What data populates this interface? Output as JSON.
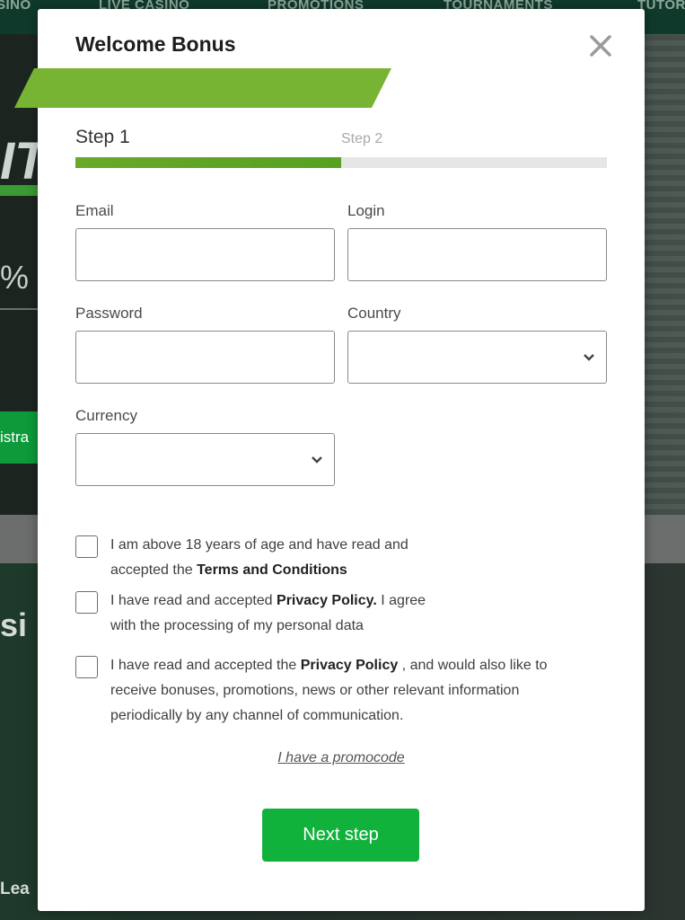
{
  "background": {
    "nav": [
      "SINO",
      "LIVE CASINO",
      "PROMOTIONS",
      "TOURNAMENTS",
      "TUTOR"
    ],
    "hero_fragment": "IT",
    "percent_fragment": "% U",
    "register_fragment": "istra",
    "casino_fragment": "si",
    "league_fragment": "Lea"
  },
  "modal": {
    "title": "Welcome Bonus",
    "close_icon": "close-icon",
    "steps": {
      "step1": "Step 1",
      "step2": "Step 2",
      "progress": 0.5
    },
    "fields": {
      "email": {
        "label": "Email",
        "value": ""
      },
      "login": {
        "label": "Login",
        "value": ""
      },
      "password": {
        "label": "Password",
        "value": ""
      },
      "country": {
        "label": "Country",
        "value": ""
      },
      "currency": {
        "label": "Currency",
        "value": ""
      }
    },
    "checkboxes": [
      {
        "line1": "I am above 18 years of age and have read and",
        "line2_pre": "accepted the ",
        "line2_bold": "Terms and Conditions"
      },
      {
        "line1_pre": "I have read and accepted ",
        "line1_bold": "Privacy Policy.",
        "line1_post": " I agree",
        "line2": "with the processing of my personal data"
      },
      {
        "line1_pre": "I have read and accepted the ",
        "line1_bold": "Privacy Policy",
        "line1_post": " , and would also like to",
        "line2": "receive bonuses, promotions, news or other relevant information",
        "line3": "periodically by any channel of communication."
      }
    ],
    "promo_link": "I have a promocode",
    "next_button": "Next step"
  },
  "colors": {
    "accent_green": "#11b23c",
    "progress_green": "#6aa829",
    "banner_green": "#78b433"
  }
}
